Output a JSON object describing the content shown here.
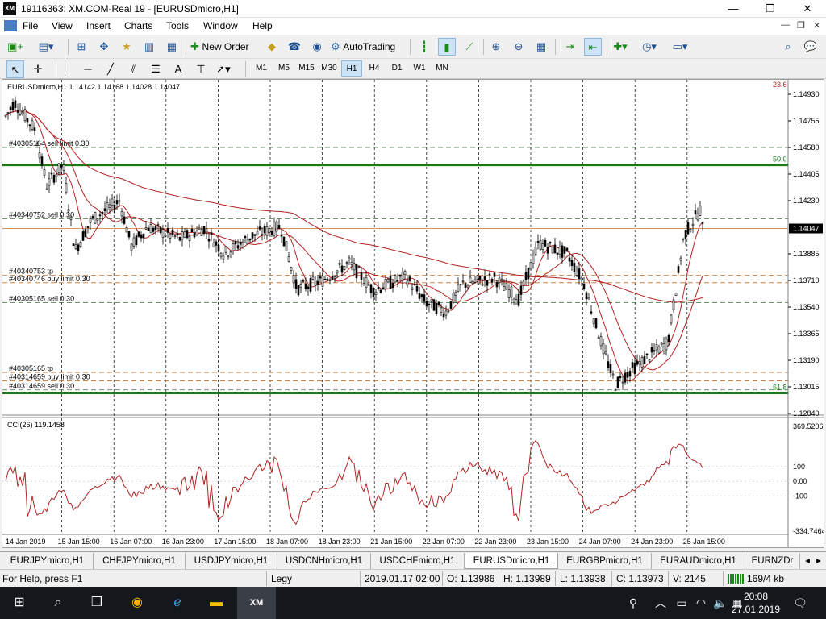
{
  "window": {
    "title": "19116363: XM.COM-Real 19 - [EURUSDmicro,H1]",
    "app_icon": "XM"
  },
  "menu": {
    "items": [
      "File",
      "View",
      "Insert",
      "Charts",
      "Tools",
      "Window",
      "Help"
    ]
  },
  "toolbar": {
    "new_order": "New Order",
    "auto_trading": "AutoTrading"
  },
  "timeframes": {
    "items": [
      "M1",
      "M5",
      "M15",
      "M30",
      "H1",
      "H4",
      "D1",
      "W1",
      "MN"
    ],
    "selected": "H1"
  },
  "chart": {
    "header": "EURUSDmicro,H1  1.14142 1.14168 1.14028 1.14047",
    "price_labels": [
      "1.14930",
      "1.14755",
      "1.14580",
      "1.14405",
      "1.14230",
      "1.14047",
      "1.13885",
      "1.13710",
      "1.13540",
      "1.13365",
      "1.13190",
      "1.13015",
      "1.12840"
    ],
    "current_price": "1.14047",
    "fib_labels": [
      "23.6",
      "50.0",
      "61.8"
    ],
    "order_labels": [
      "#40305164 sell limit 0.30",
      "#40340752 sell 0.30",
      "#40340753 tp",
      "#40340746 buy limit 0.30",
      "#40305165 sell 0.30",
      "#40305165 tp",
      "#40314659 buy limit 0.30",
      "#40314659 sell 0.30"
    ],
    "time_labels": [
      "14 Jan 2019",
      "15 Jan 15:00",
      "16 Jan 07:00",
      "16 Jan 23:00",
      "17 Jan 15:00",
      "18 Jan 07:00",
      "18 Jan 23:00",
      "21 Jan 15:00",
      "22 Jan 07:00",
      "22 Jan 23:00",
      "23 Jan 15:00",
      "24 Jan 07:00",
      "24 Jan 23:00",
      "25 Jan 15:00"
    ],
    "indicator": {
      "header": "CCI(26) 119.1458",
      "scale_labels": [
        "369.5206",
        "100",
        "0.00",
        "-100",
        "-334.7464"
      ]
    },
    "colors": {
      "bull": "#000000",
      "bear": "#000000",
      "ma": "#b22222",
      "green_line": "#1a7a1a",
      "order": "#3c6e3c",
      "cci": "#b22222"
    }
  },
  "tabs": {
    "items": [
      "EURJPYmicro,H1",
      "CHFJPYmicro,H1",
      "USDJPYmicro,H1",
      "USDCNHmicro,H1",
      "USDCHFmicro,H1",
      "EURUSDmicro,H1",
      "EURGBPmicro,H1",
      "EURAUDmicro,H1",
      "EURNZDr"
    ],
    "active": "EURUSDmicro,H1"
  },
  "status": {
    "help": "For Help, press F1",
    "profile": "Legy",
    "datetime": "2019.01.17 02:00",
    "open": "O: 1.13986",
    "high": "H: 1.13989",
    "low": "L: 1.13938",
    "close": "C: 1.13973",
    "volume": "V: 2145",
    "traffic": "169/4 kb"
  },
  "taskbar": {
    "time": "20:08",
    "date": "27.01.2019"
  }
}
